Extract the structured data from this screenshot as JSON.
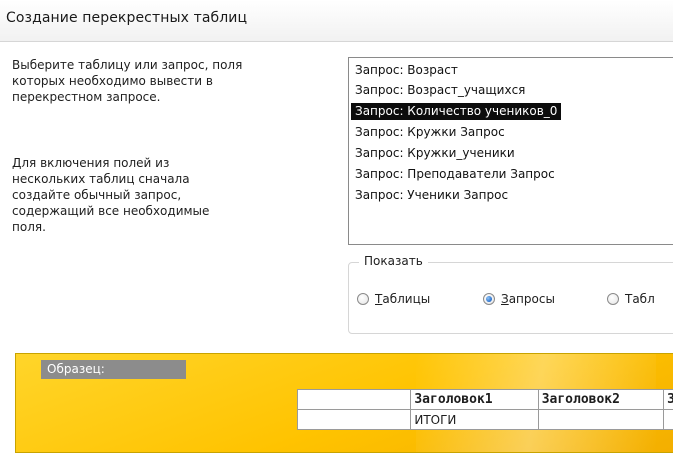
{
  "dialog": {
    "title": "Создание перекрестных таблиц"
  },
  "instructions": {
    "first": "Выберите таблицу или запрос, поля\nкоторых необходимо вывести в\nперекрестном запросе.",
    "second": "Для включения полей из\nнескольких таблиц сначала\nсоздайте обычный запрос,\nсодержащий все необходимые\nполя."
  },
  "source_list": {
    "items": [
      "Запрос: Возраст",
      "Запрос: Возраст_учащихся",
      "Запрос: Количество учеников_0",
      "Запрос: Кружки Запрос",
      "Запрос: Кружки_ученики",
      "Запрос: Преподаватели Запрос",
      "Запрос: Ученики Запрос"
    ],
    "selected_index": 2
  },
  "show_group": {
    "legend": "Показать",
    "options": [
      {
        "label": "Таблицы",
        "accel": "Т",
        "checked": false
      },
      {
        "label": "Запросы",
        "accel": "З",
        "checked": true
      },
      {
        "label": "Табл",
        "accel": "",
        "checked": false
      }
    ]
  },
  "sample": {
    "label": "Образец:",
    "header_cells": [
      "",
      "Заголовок1",
      "Заголовок2",
      "З"
    ],
    "row_label": "ИТОГИ"
  },
  "colors": {
    "selection": "#0c0c0c",
    "sample_background": "#ffc300",
    "radio_checked": "#1a63c6"
  }
}
